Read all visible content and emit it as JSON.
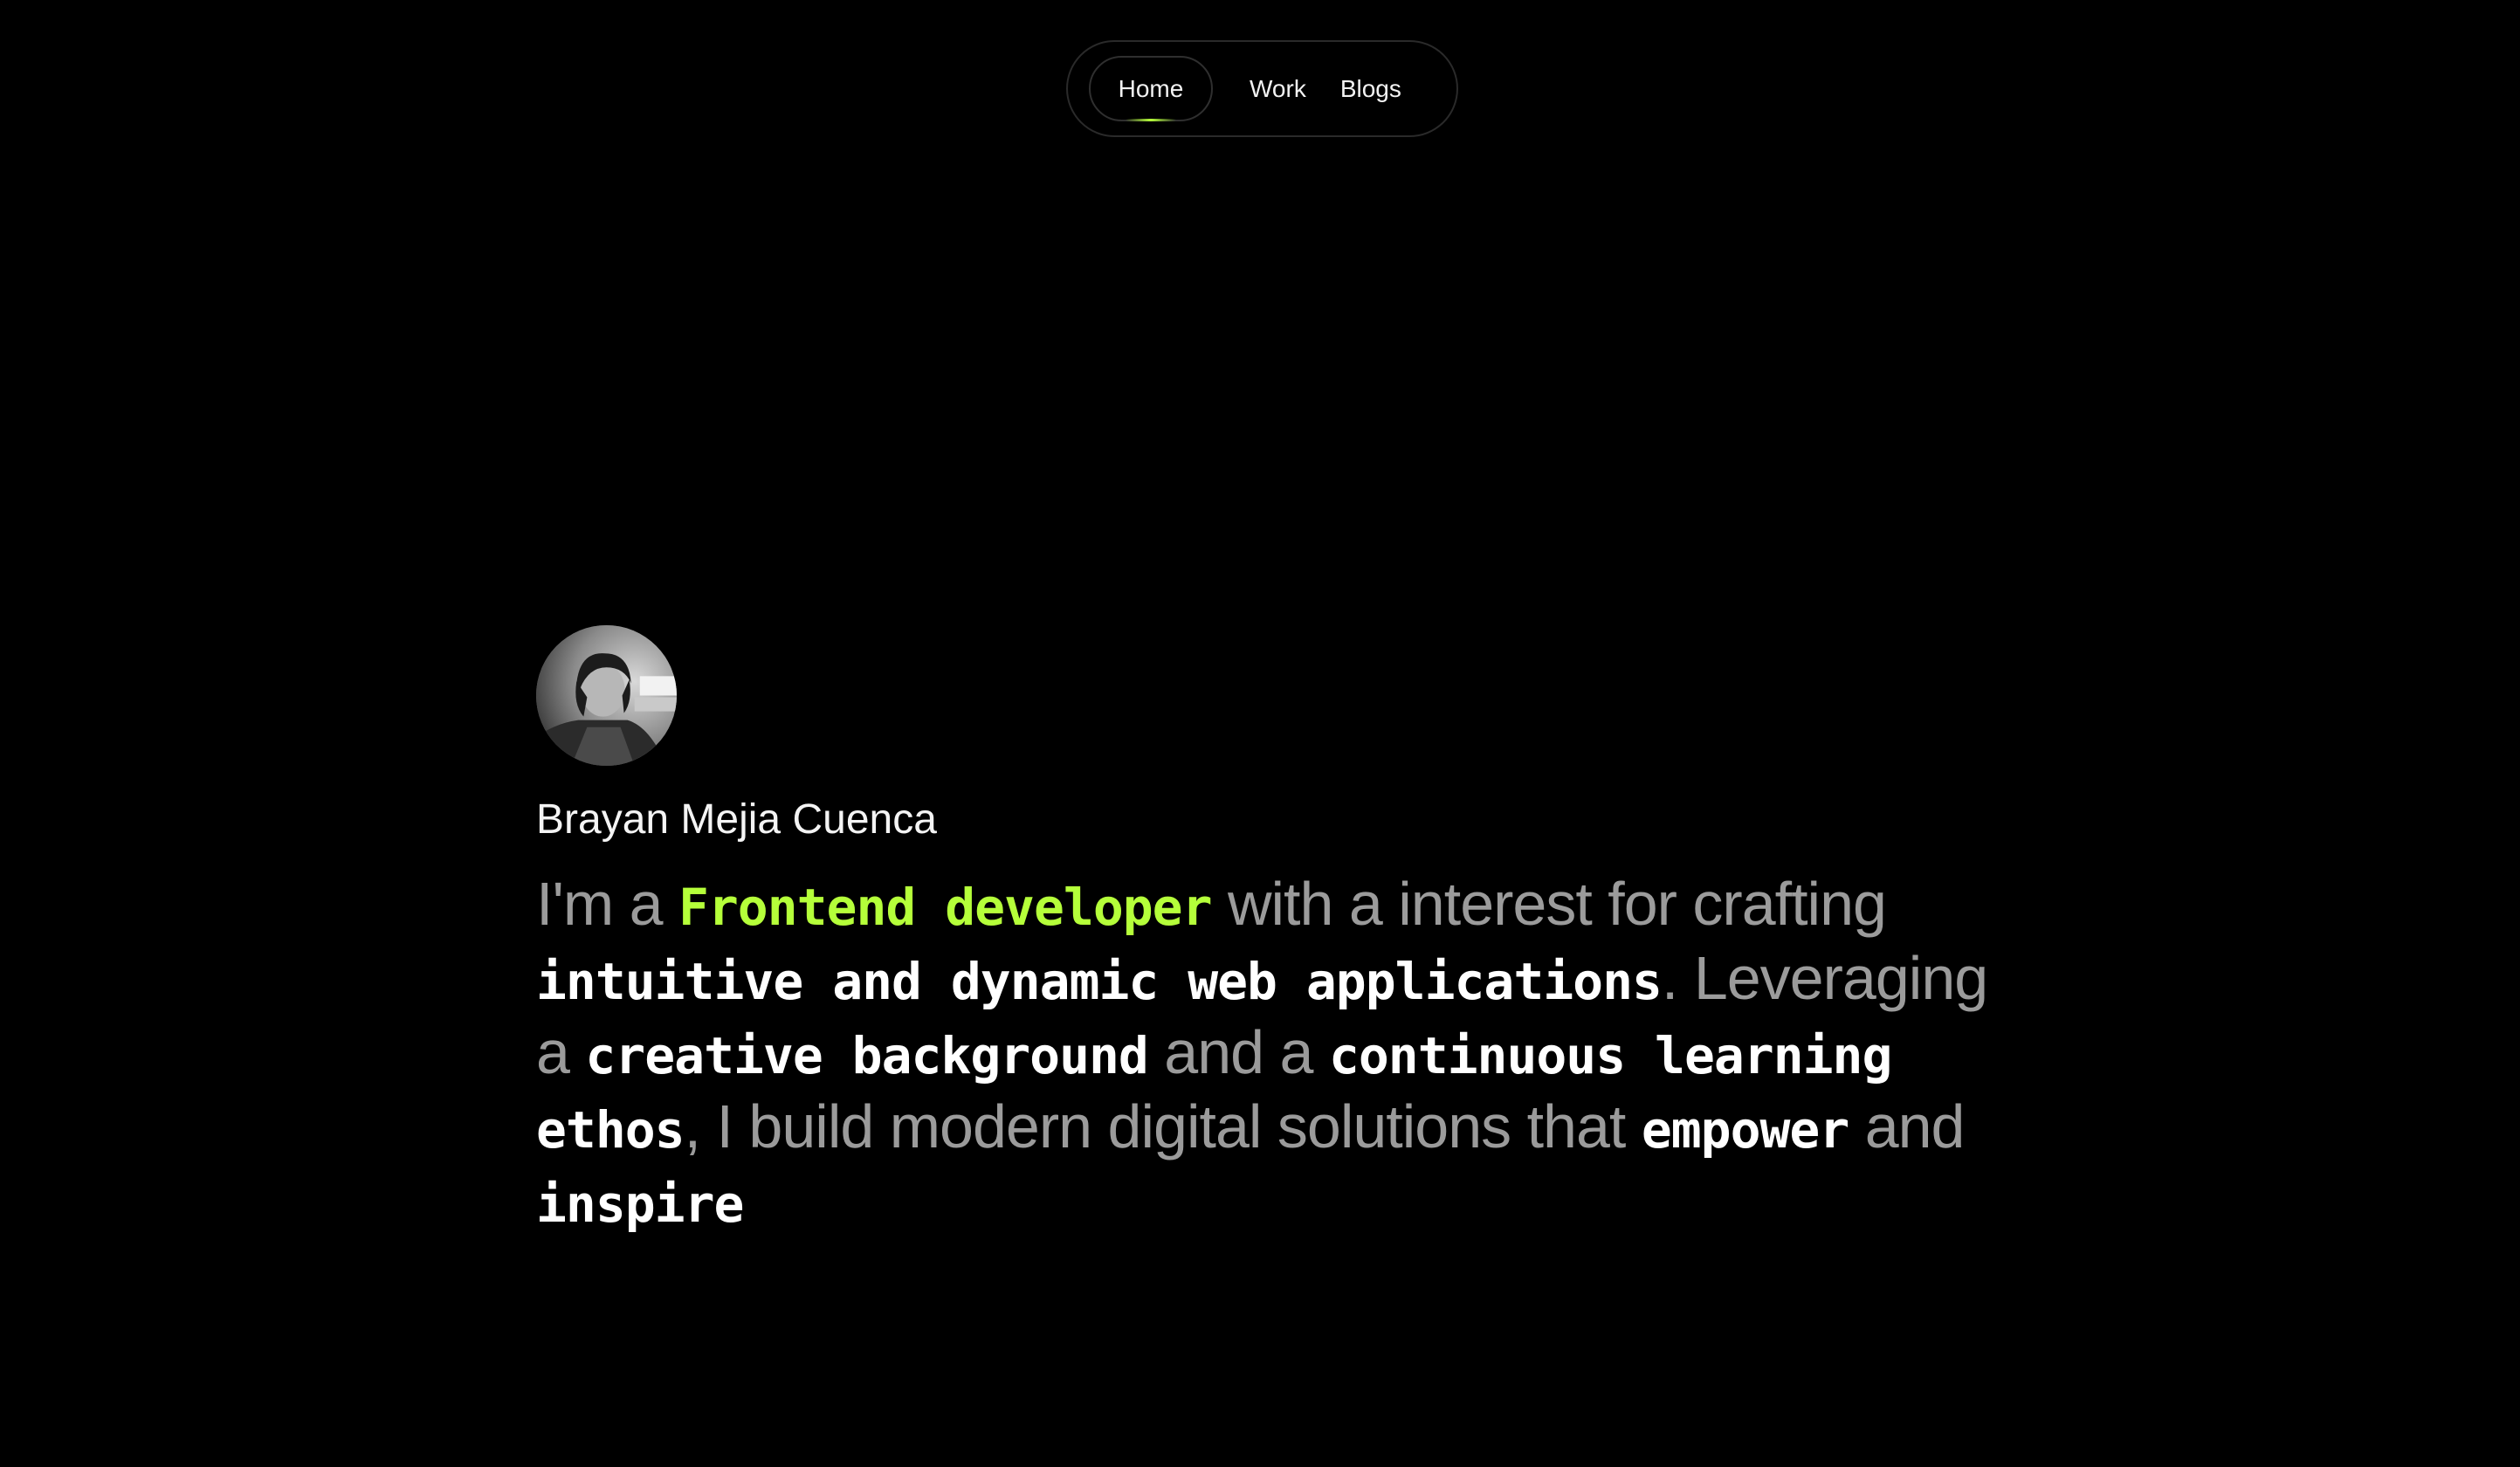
{
  "nav": {
    "items": [
      {
        "label": "Home",
        "active": true
      },
      {
        "label": "Work",
        "active": false
      },
      {
        "label": "Blogs",
        "active": false
      }
    ]
  },
  "profile": {
    "name": "Brayan Mejia Cuenca",
    "avatar_icon": "profile-photo"
  },
  "bio": {
    "seg1": "I'm a ",
    "highlight_role": "Frontend developer",
    "seg2": " with a interest for crafting ",
    "em1": "intuitive and dynamic web applications",
    "seg3": ". Leveraging a ",
    "em2": "creative background",
    "seg4": " and a ",
    "em3": "continuous learning ethos",
    "seg5": ", I build modern digital solutions that ",
    "em4": "empower",
    "seg6": " and ",
    "em5": "inspire"
  },
  "colors": {
    "background": "#000000",
    "accent": "#b5ff3a",
    "muted_text": "#9b9b9b",
    "strong_text": "#ffffff"
  }
}
